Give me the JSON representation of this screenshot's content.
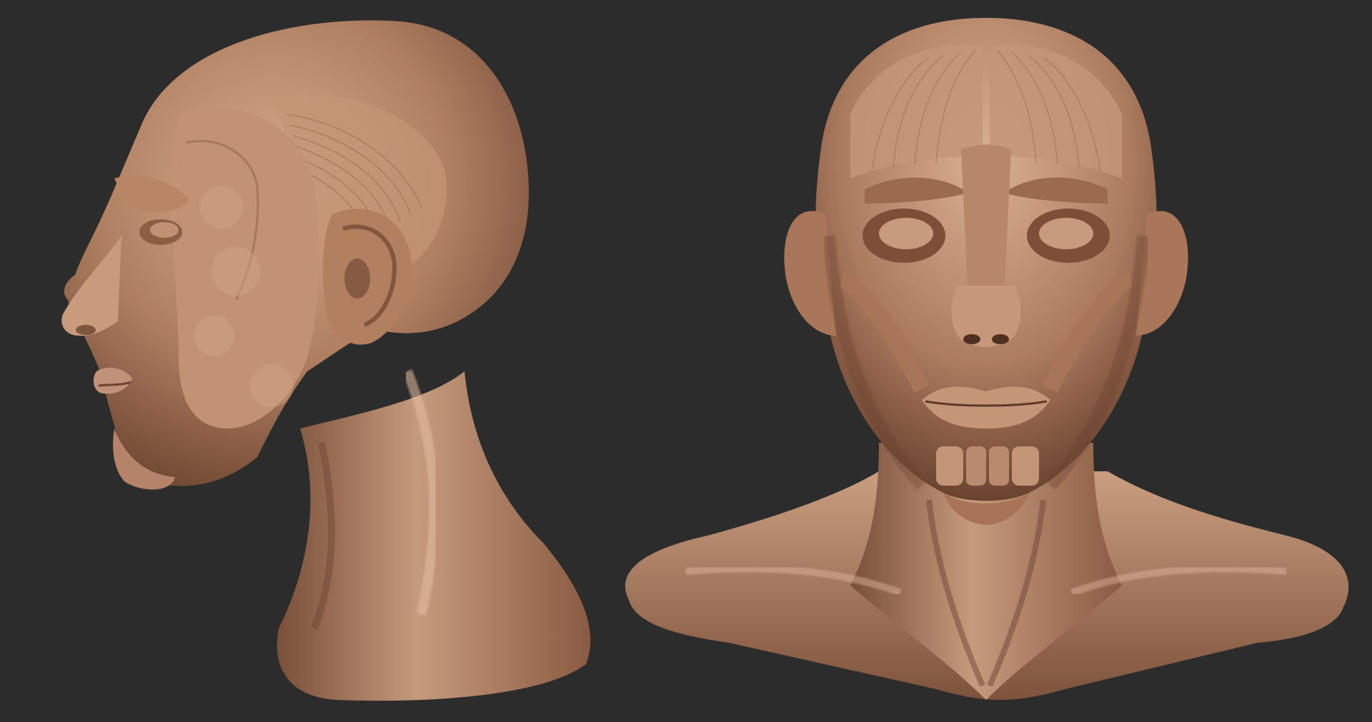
{
  "scene": {
    "background_color": "#2c2c2d",
    "material_base_color": "#b8876a",
    "material_highlight_color": "#e0b89c",
    "material_shadow_color": "#5a3a28",
    "views": [
      {
        "view": "profile-left",
        "subject": "ecorche-head-sculpt"
      },
      {
        "view": "front",
        "subject": "ecorche-head-and-shoulders-sculpt"
      }
    ]
  }
}
